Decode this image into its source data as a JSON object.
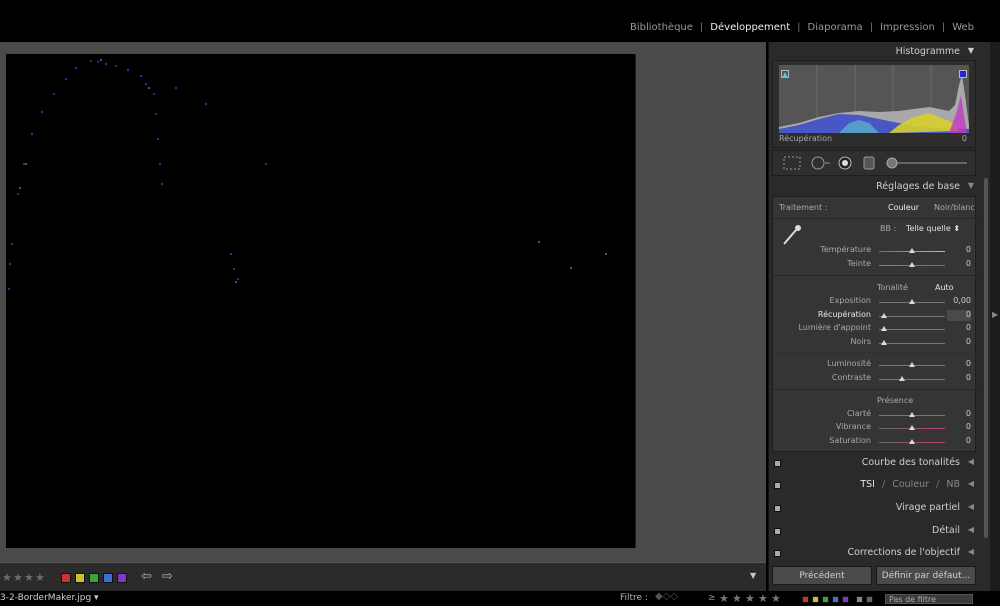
{
  "modules": [
    "Bibliothèque",
    "Développement",
    "Diaporama",
    "Impression",
    "Web"
  ],
  "active_module": "Développement",
  "right_panel": {
    "histogram": {
      "title": "Histogramme",
      "readout_label": "Récupération",
      "readout_value": "0"
    },
    "basic": {
      "title": "Réglages de base",
      "treatment_label": "Traitement :",
      "treatment_color": "Couleur",
      "treatment_bw": "Noir/blanc",
      "wb_label": "BB :",
      "wb_value": "Telle quelle ⬍",
      "temperature": {
        "label": "Température",
        "value": "0"
      },
      "tint": {
        "label": "Teinte",
        "value": "0"
      },
      "tone_label": "Tonalité",
      "auto_label": "Auto",
      "exposure": {
        "label": "Exposition",
        "value": "0,00"
      },
      "recovery": {
        "label": "Récupération",
        "value": "0"
      },
      "fill_light": {
        "label": "Lumière d'appoint",
        "value": "0"
      },
      "blacks": {
        "label": "Noirs",
        "value": "0"
      },
      "brightness": {
        "label": "Luminosité",
        "value": "0"
      },
      "contrast": {
        "label": "Contraste",
        "value": "0"
      },
      "presence_label": "Présence",
      "clarity": {
        "label": "Clarté",
        "value": "0"
      },
      "vibrance": {
        "label": "Vibrance",
        "value": "0"
      },
      "saturation": {
        "label": "Saturation",
        "value": "0"
      }
    },
    "tone_curve": "Courbe des tonalités",
    "hsl": {
      "tsi": "TSI",
      "sep": "/",
      "color": "Couleur",
      "nb": "NB"
    },
    "split_toning": "Virage partiel",
    "detail": "Détail",
    "lens": "Corrections de l'objectif",
    "previous_button": "Précédent",
    "reset_button": "Définir par défaut..."
  },
  "toolbar": {
    "stars": [
      "★",
      "★",
      "★",
      "★"
    ],
    "color_labels": [
      "#c93535",
      "#c9c12e",
      "#3da33d",
      "#3b6fd0",
      "#7a3bc9"
    ],
    "back_arrow": "⇦",
    "forward_arrow": "⇨",
    "menu_arrow": "▼"
  },
  "status": {
    "filename": "3-2-BorderMaker.jpg",
    "filename_arrow": "▾",
    "filter_label": "Filtre :",
    "filter_value": "Pas de filtre",
    "rating_op": "≥",
    "stars": [
      "★",
      "★",
      "★",
      "★",
      "★"
    ]
  }
}
